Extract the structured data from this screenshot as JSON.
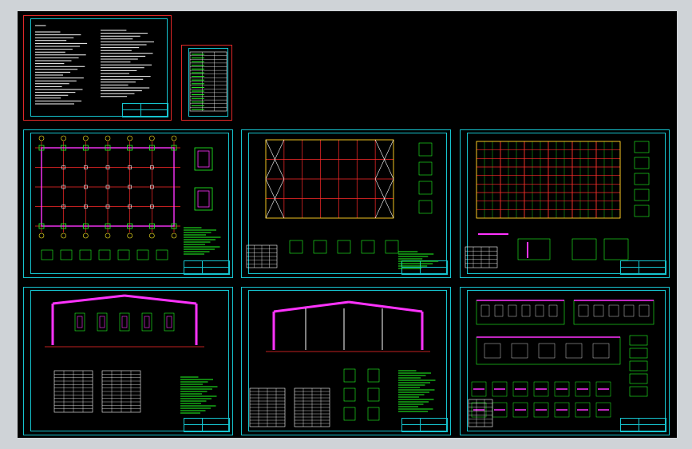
{
  "viewer": {
    "background_color": "#000000",
    "page_color": "#cfd3d7"
  },
  "colors": {
    "sheet_border_main": "#16c4cf",
    "sheet_border_cover": "#e02828",
    "grid_red": "#ff2a2a",
    "steel_magenta": "#ff33ff",
    "text_green": "#22ff22",
    "text_white": "#ffffff",
    "axis_yellow": "#ffee22"
  },
  "sheets": [
    {
      "id": "cover-notes",
      "kind": "general-notes",
      "border": "red"
    },
    {
      "id": "drawing-index",
      "kind": "drawing-index-table",
      "border": "red"
    },
    {
      "id": "foundation-plan",
      "kind": "plan",
      "border": "cyan"
    },
    {
      "id": "bracing-plan",
      "kind": "plan",
      "border": "cyan"
    },
    {
      "id": "roof-purlin-plan",
      "kind": "plan",
      "border": "cyan"
    },
    {
      "id": "frame-elevation-1",
      "kind": "elevation",
      "border": "cyan"
    },
    {
      "id": "frame-elevation-2",
      "kind": "elevation",
      "border": "cyan"
    },
    {
      "id": "wall-elevations-details",
      "kind": "elevation-details",
      "border": "cyan"
    }
  ],
  "icons": [
    "title-block-icon",
    "grid-axis-icon",
    "section-detail-icon"
  ]
}
